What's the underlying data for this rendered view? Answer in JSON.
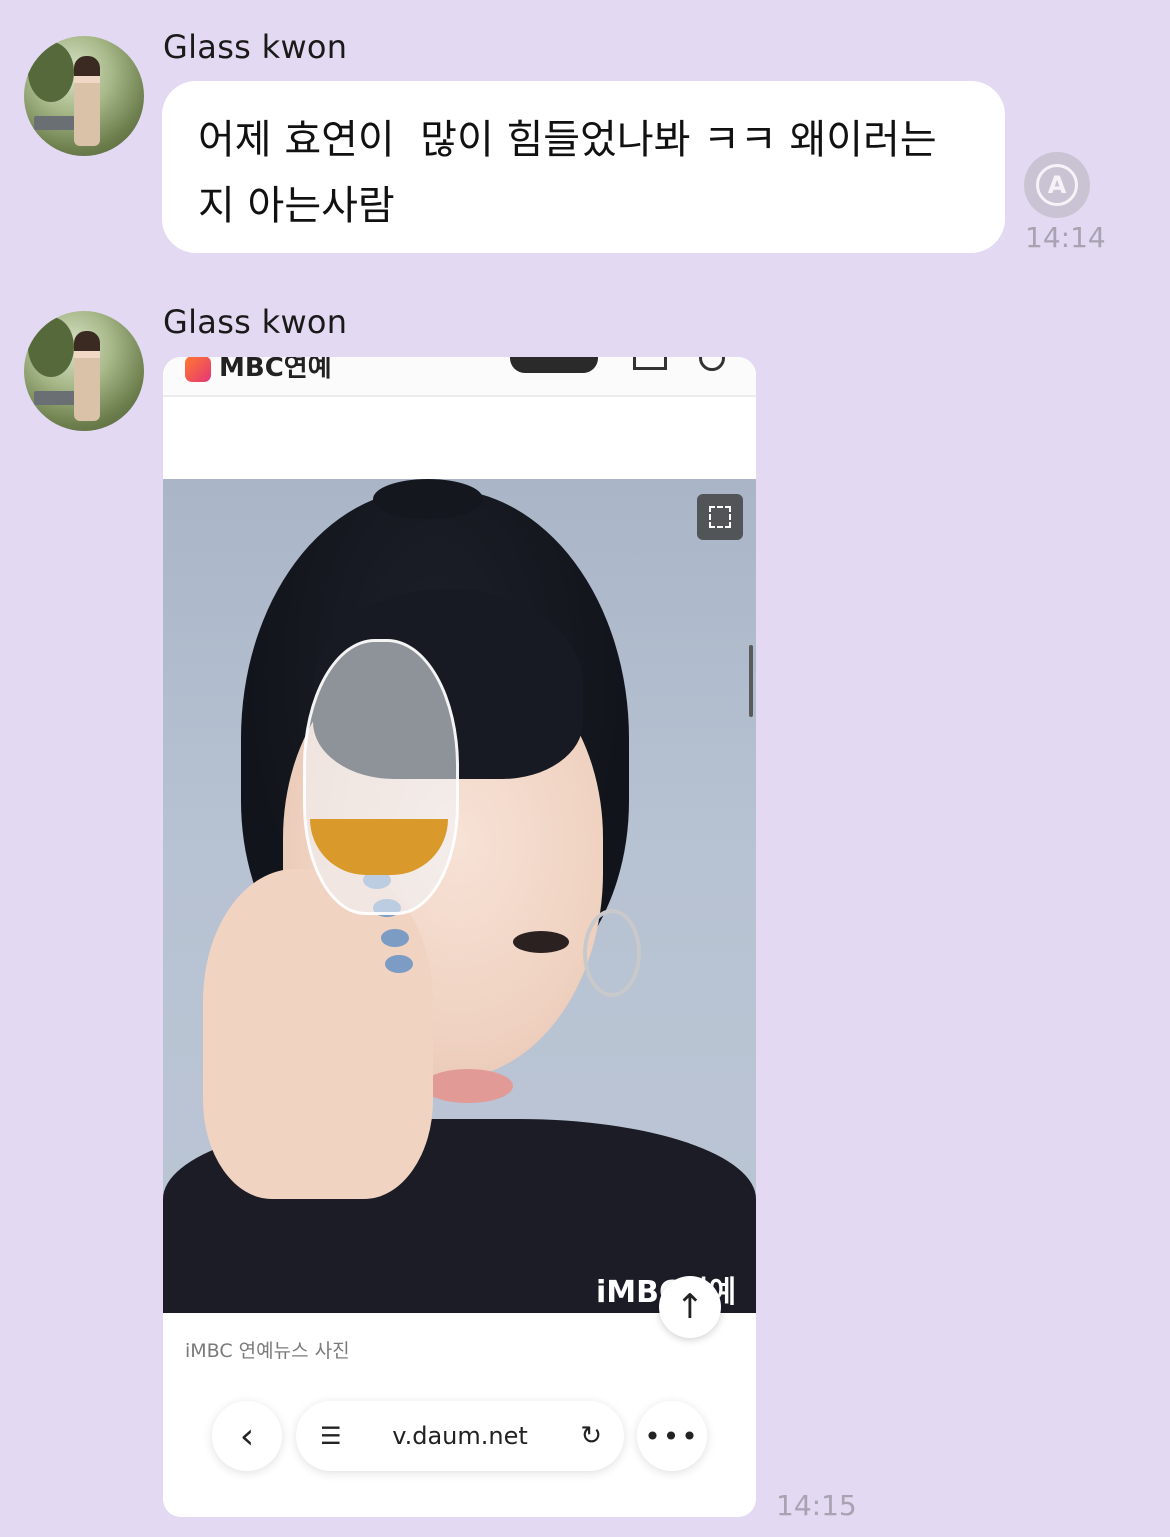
{
  "messages": [
    {
      "sender": "Glass kwon",
      "text": "어제 효연이  많이 힘들었나봐 ㅋㅋ 왜이러는\n지 아는사람",
      "time": "14:14",
      "status_icon": "auto-translate-icon",
      "status_icon_letter": "A"
    },
    {
      "sender": "Glass kwon",
      "time": "14:15",
      "attachment": {
        "type": "screenshot",
        "header_brand": "MBC연예",
        "image_watermark": "iMBC연예",
        "caption": "iMBC 연예뉴스 사진",
        "url": "v.daum.net",
        "icons": {
          "expand": "expand-icon",
          "scroll_top": "arrow-up-icon",
          "back": "chevron-left-icon",
          "tabs": "tabs-icon",
          "reload": "reload-icon",
          "more": "more-icon"
        },
        "glyphs": {
          "scroll_top": "↑",
          "back": "‹",
          "tabs": "☰",
          "reload": "↻",
          "more": "•••"
        }
      }
    }
  ],
  "colors": {
    "background": "#e3d9f2",
    "bubble": "#ffffff",
    "time_text": "#a8a2b1"
  }
}
